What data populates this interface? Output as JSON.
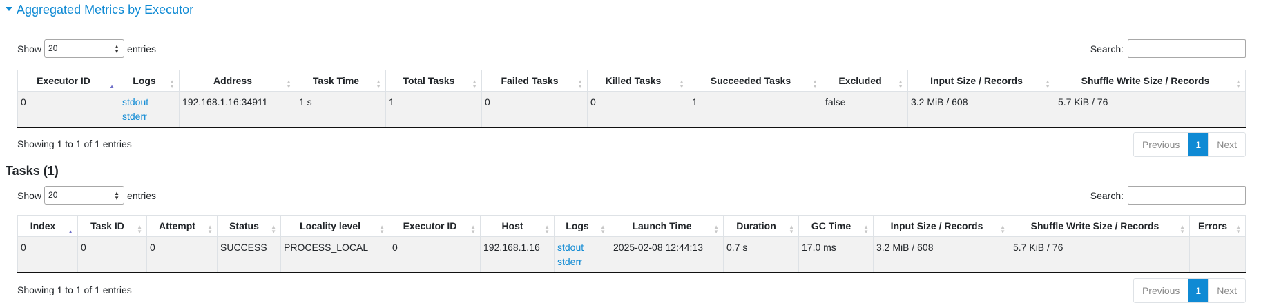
{
  "executors": {
    "title": "Aggregated Metrics by Executor",
    "show_label": "Show",
    "page_size": "20",
    "entries_label": "entries",
    "search_label": "Search:",
    "columns": [
      "Executor ID",
      "Logs",
      "Address",
      "Task Time",
      "Total Tasks",
      "Failed Tasks",
      "Killed Tasks",
      "Succeeded Tasks",
      "Excluded",
      "Input Size / Records",
      "Shuffle Write Size / Records"
    ],
    "row": {
      "executor_id": "0",
      "stdout": "stdout",
      "stderr": "stderr",
      "address": "192.168.1.16:34911",
      "task_time": "1 s",
      "total_tasks": "1",
      "failed_tasks": "0",
      "killed_tasks": "0",
      "succeeded_tasks": "1",
      "excluded": "false",
      "input": "3.2 MiB / 608",
      "shuffle_write": "5.7 KiB / 76"
    },
    "info": "Showing 1 to 1 of 1 entries",
    "pager": {
      "previous": "Previous",
      "current": "1",
      "next": "Next"
    }
  },
  "tasks": {
    "title": "Tasks (1)",
    "show_label": "Show",
    "page_size": "20",
    "entries_label": "entries",
    "search_label": "Search:",
    "columns": [
      "Index",
      "Task ID",
      "Attempt",
      "Status",
      "Locality level",
      "Executor ID",
      "Host",
      "Logs",
      "Launch Time",
      "Duration",
      "GC Time",
      "Input Size / Records",
      "Shuffle Write Size / Records",
      "Errors"
    ],
    "row": {
      "index": "0",
      "task_id": "0",
      "attempt": "0",
      "status": "SUCCESS",
      "locality": "PROCESS_LOCAL",
      "executor_id": "0",
      "host": "192.168.1.16",
      "stdout": "stdout",
      "stderr": "stderr",
      "launch_time": "2025-02-08 12:44:13",
      "duration": "0.7 s",
      "gc_time": "17.0 ms",
      "input": "3.2 MiB / 608",
      "shuffle_write": "5.7 KiB / 76",
      "errors": ""
    },
    "info": "Showing 1 to 1 of 1 entries",
    "pager": {
      "previous": "Previous",
      "current": "1",
      "next": "Next"
    }
  }
}
